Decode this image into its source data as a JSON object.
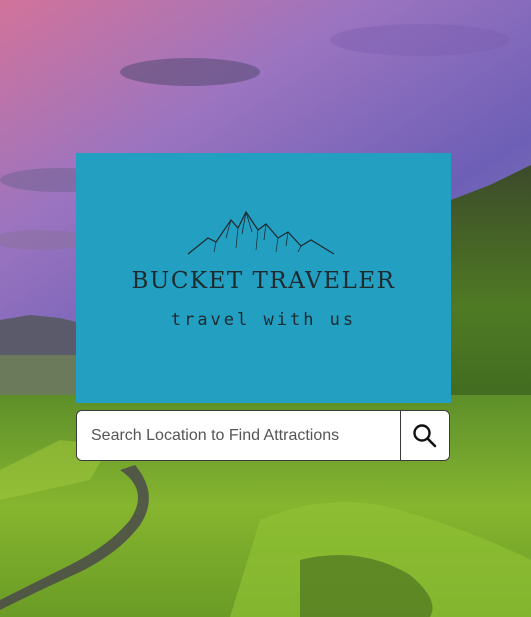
{
  "logo": {
    "brand_name": "BUCKET TRAVELER",
    "tagline": "travel with us",
    "card_color": "#239fc2"
  },
  "search": {
    "placeholder": "Search Location to Find Attractions",
    "value": "",
    "button_icon": "search-icon"
  },
  "background": {
    "description_icon": "landscape-photo"
  }
}
